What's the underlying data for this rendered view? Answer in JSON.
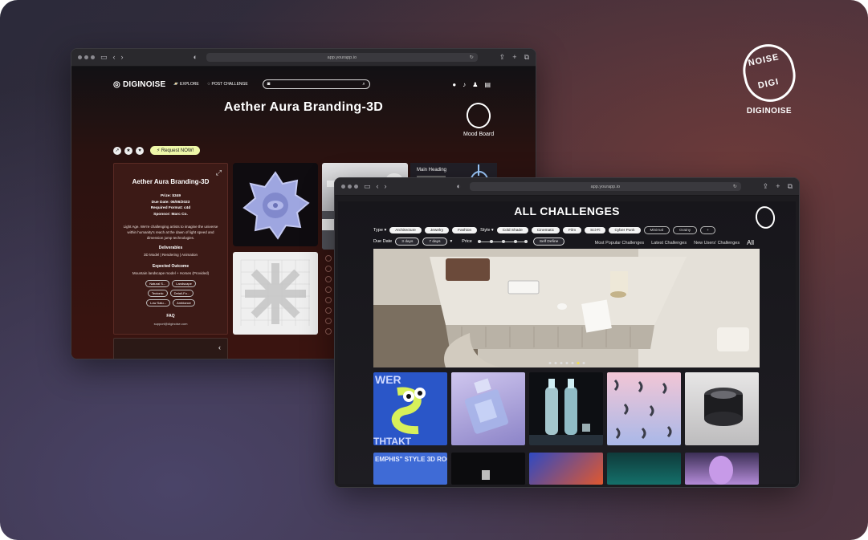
{
  "brand": {
    "name": "DIGINOISE",
    "ring_text": [
      "NOISE",
      "DIGI"
    ]
  },
  "browser": {
    "url": "app.yourapp.io"
  },
  "window1": {
    "nav": {
      "logo": "DIGINOISE",
      "explore": "EXPLORE",
      "post": "POST CHALLENGE"
    },
    "title": "Aether Aura Branding-3D",
    "mood_board": "Mood Board",
    "request_label": "Request NOW!",
    "card": {
      "title": "Aether Aura Branding-3D",
      "prize": "Prize: $349",
      "due": "Due Date: 06/06/2023",
      "format": "Required Format: c4d",
      "sponsor": "Sponsor: Marc Co.",
      "description": "Light Age. We're challenging artists to imagine the universe within humanity's reach at the dawn of light speed and dimension jump technologies.",
      "deliverables_h": "Deliverables",
      "deliverables": "3D Model | Rendering | Animation",
      "outcome_h": "Expected Outcome",
      "outcome": "Mountain landscape model + Horses (Provided)",
      "tags": [
        "Natural S...",
        "Landscape",
        "Tectonic",
        "Detail-Fo...",
        "Low Satu...",
        "Ambiance"
      ],
      "faq": "FAQ",
      "mail": "support@diginoise.com"
    },
    "mock_heading": "Main Heading"
  },
  "window2": {
    "title": "ALL CHALLENGES",
    "type_label": "Type",
    "types": [
      "Architecture",
      "Jewelry",
      "Fashion"
    ],
    "style_label": "Style",
    "styles": [
      "Cold Shade",
      "Cinematic",
      "Film",
      "Sci-Fi",
      "Cyber Punk",
      "Minimal",
      "Grainy"
    ],
    "more": "+",
    "due_label": "Due Date",
    "due_opts": [
      "3 days",
      "7 days"
    ],
    "price_label": "Price",
    "self_define": "Self Define",
    "sorts": [
      "Most Popular Challenges",
      "Latest Challenges",
      "New Users' Challenges"
    ],
    "all": "All",
    "tile_text": [
      "WER",
      "THTAKT",
      "EMPHIS\" STYLE 3D ROO"
    ]
  },
  "colors": {
    "accent": "#f3e24a",
    "request_bg": "#eef7a8"
  }
}
